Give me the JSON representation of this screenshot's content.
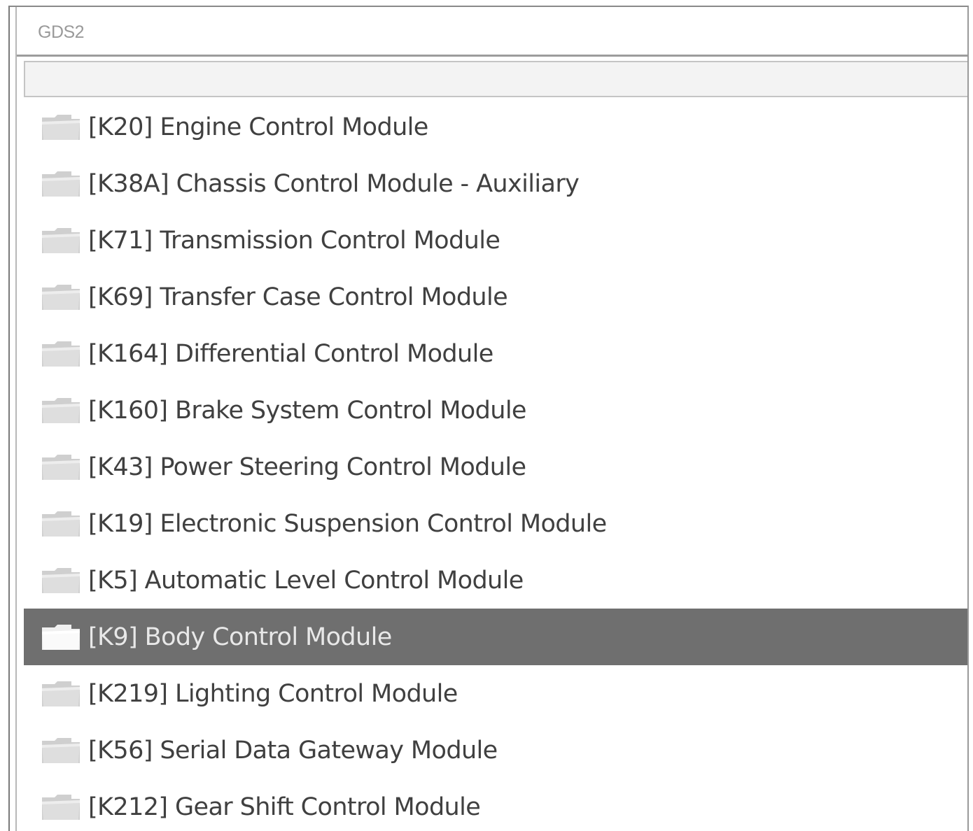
{
  "window": {
    "title": "GDS2"
  },
  "search": {
    "value": "",
    "placeholder": ""
  },
  "module_list": {
    "items": [
      {
        "label": "[K20] Engine Control Module",
        "selected": false,
        "icon": "folder-icon"
      },
      {
        "label": "[K38A] Chassis Control Module - Auxiliary",
        "selected": false,
        "icon": "folder-icon"
      },
      {
        "label": "[K71] Transmission Control Module",
        "selected": false,
        "icon": "folder-icon"
      },
      {
        "label": "[K69] Transfer Case Control Module",
        "selected": false,
        "icon": "folder-icon"
      },
      {
        "label": "[K164] Differential Control Module",
        "selected": false,
        "icon": "folder-icon"
      },
      {
        "label": "[K160] Brake System Control Module",
        "selected": false,
        "icon": "folder-icon"
      },
      {
        "label": "[K43] Power Steering Control Module",
        "selected": false,
        "icon": "folder-icon"
      },
      {
        "label": "[K19] Electronic Suspension Control Module",
        "selected": false,
        "icon": "folder-icon"
      },
      {
        "label": "[K5] Automatic Level Control Module",
        "selected": false,
        "icon": "folder-icon"
      },
      {
        "label": "[K9] Body Control Module",
        "selected": true,
        "icon": "folder-icon"
      },
      {
        "label": "[K219] Lighting Control Module",
        "selected": false,
        "icon": "folder-icon"
      },
      {
        "label": "[K56] Serial Data Gateway Module",
        "selected": false,
        "icon": "folder-icon"
      },
      {
        "label": "[K212] Gear Shift Control Module",
        "selected": false,
        "icon": "folder-icon"
      }
    ]
  },
  "colors": {
    "selected_row": "#6f6f6f",
    "text": "#404040",
    "selected_text": "#e8e8e8",
    "folder": "#d6d6d6",
    "folder_selected": "#f0f0f0"
  }
}
